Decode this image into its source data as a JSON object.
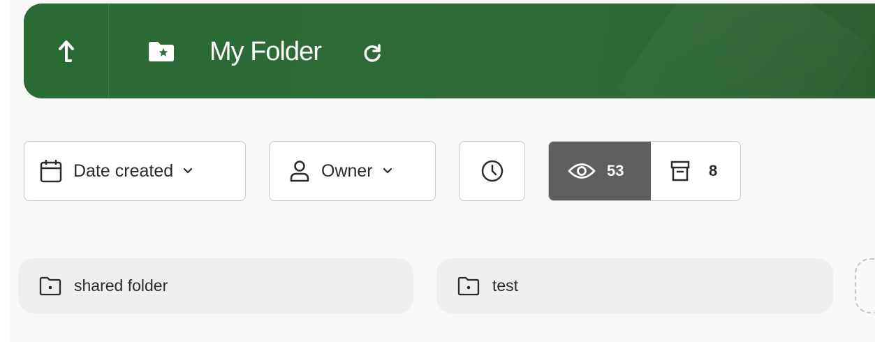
{
  "header": {
    "title": "My Folder",
    "up_icon": "up-arrow-icon",
    "folder_icon": "starred-folder-icon",
    "refresh_icon": "refresh-icon",
    "color": "#2c6a37"
  },
  "filters": {
    "date_created": {
      "label": "Date created",
      "icon": "calendar-icon"
    },
    "owner": {
      "label": "Owner",
      "icon": "person-icon"
    },
    "recent_icon": "clock-icon"
  },
  "view_toggle": {
    "visible": {
      "icon": "eye-icon",
      "count": "53",
      "active": true
    },
    "archived": {
      "icon": "archive-icon",
      "count": "8",
      "active": false
    }
  },
  "folders": [
    {
      "name": "shared folder",
      "icon": "folder-icon"
    },
    {
      "name": "test",
      "icon": "folder-icon"
    }
  ]
}
